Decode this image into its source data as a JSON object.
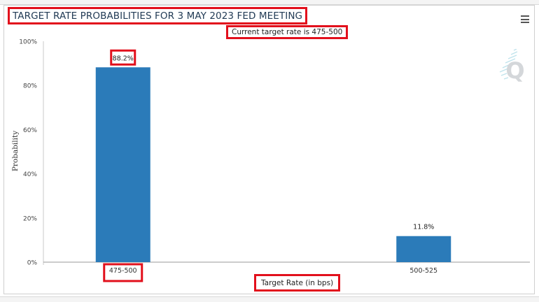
{
  "chart_data": {
    "type": "bar",
    "title": "TARGET RATE PROBABILITIES FOR 3 MAY 2023 FED MEETING",
    "subtitle": "Current target rate is 475-500",
    "xlabel": "Target Rate (in bps)",
    "ylabel": "Probability",
    "categories": [
      "475-500",
      "500-525"
    ],
    "values": [
      88.2,
      11.8
    ],
    "data_labels": [
      "88.2%",
      "11.8%"
    ],
    "ylim": [
      0,
      100
    ],
    "yticks": [
      "0%",
      "20%",
      "40%",
      "60%",
      "80%",
      "100%"
    ],
    "ytick_values": [
      0,
      20,
      40,
      60,
      80,
      100
    ],
    "bar_color": "#2b7bb9",
    "highlight_color": "#e2101c",
    "grid": false,
    "legend": "none"
  },
  "menu": {
    "icon": "hamburger-menu-icon"
  },
  "watermark": {
    "letter": "Q"
  }
}
